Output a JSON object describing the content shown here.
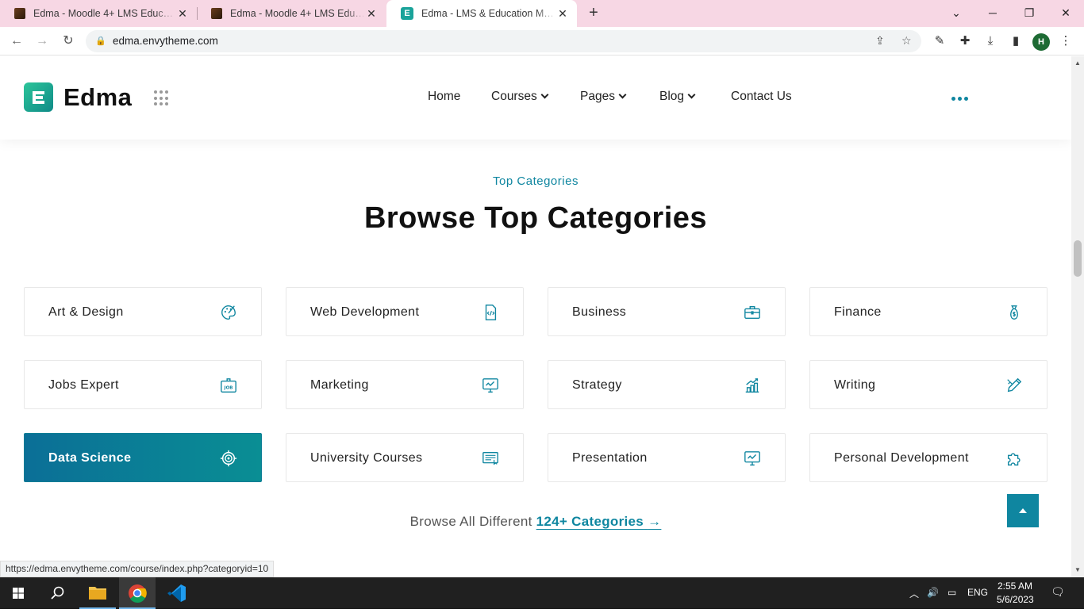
{
  "browser": {
    "tabs": [
      {
        "title": "Edma - Moodle 4+ LMS Education",
        "active": false
      },
      {
        "title": "Edma - Moodle 4+ LMS Education",
        "active": false
      },
      {
        "title": "Edma - LMS & Education Moodle",
        "active": true
      }
    ],
    "url": "edma.envytheme.com",
    "profile_initial": "H"
  },
  "site": {
    "brand": "Edma",
    "menu": [
      {
        "label": "Home",
        "dropdown": false
      },
      {
        "label": "Courses",
        "dropdown": true
      },
      {
        "label": "Pages",
        "dropdown": true
      },
      {
        "label": "Blog",
        "dropdown": true
      },
      {
        "label": "Contact Us",
        "dropdown": false
      }
    ]
  },
  "section": {
    "subtitle": "Top Categories",
    "title": "Browse Top Categories",
    "categories": [
      {
        "label": "Art & Design",
        "icon": "palette-icon"
      },
      {
        "label": "Web Development",
        "icon": "code-file-icon"
      },
      {
        "label": "Business",
        "icon": "briefcase-icon"
      },
      {
        "label": "Finance",
        "icon": "money-bag-icon"
      },
      {
        "label": "Jobs Expert",
        "icon": "job-sign-icon"
      },
      {
        "label": "Marketing",
        "icon": "monitor-chart-icon"
      },
      {
        "label": "Strategy",
        "icon": "bar-chart-icon"
      },
      {
        "label": "Writing",
        "icon": "pencil-ruler-icon"
      },
      {
        "label": "Data Science",
        "icon": "target-icon",
        "active": true
      },
      {
        "label": "University Courses",
        "icon": "certificate-icon"
      },
      {
        "label": "Presentation",
        "icon": "presentation-icon"
      },
      {
        "label": "Personal Development",
        "icon": "puzzle-icon"
      }
    ],
    "browse_prefix": "Browse All Different",
    "browse_link": "124+ Categories"
  },
  "status_url": "https://edma.envytheme.com/course/index.php?categoryid=10",
  "taskbar": {
    "lang": "ENG",
    "time": "2:55 AM",
    "date": "5/6/2023"
  },
  "colors": {
    "accent": "#0f86a0",
    "tab_bar": "#f7d7e4",
    "active_card_from": "#0b6f97",
    "active_card_to": "#0a8e94"
  }
}
